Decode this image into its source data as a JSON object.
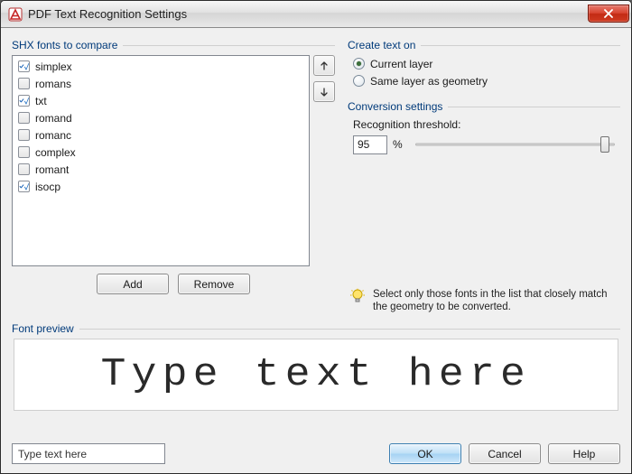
{
  "window": {
    "title": "PDF Text Recognition Settings"
  },
  "shx": {
    "group_label": "SHX fonts to compare",
    "items": [
      {
        "label": "simplex",
        "checked": true
      },
      {
        "label": "romans",
        "checked": false
      },
      {
        "label": "txt",
        "checked": true
      },
      {
        "label": "romand",
        "checked": false
      },
      {
        "label": "romanc",
        "checked": false
      },
      {
        "label": "complex",
        "checked": false
      },
      {
        "label": "romant",
        "checked": false
      },
      {
        "label": "isocp",
        "checked": true
      }
    ],
    "add_label": "Add",
    "remove_label": "Remove"
  },
  "create_text": {
    "group_label": "Create text on",
    "current_layer": "Current layer",
    "same_layer": "Same layer as geometry",
    "selected": "current"
  },
  "conversion": {
    "group_label": "Conversion settings",
    "threshold_label": "Recognition threshold:",
    "value": "95",
    "percent": "%"
  },
  "hint": {
    "text": "Select only those fonts in the list that closely match the geometry to be converted."
  },
  "preview": {
    "group_label": "Font preview",
    "sample": "Type text here",
    "input_value": "Type text here"
  },
  "buttons": {
    "ok": "OK",
    "cancel": "Cancel",
    "help": "Help"
  }
}
